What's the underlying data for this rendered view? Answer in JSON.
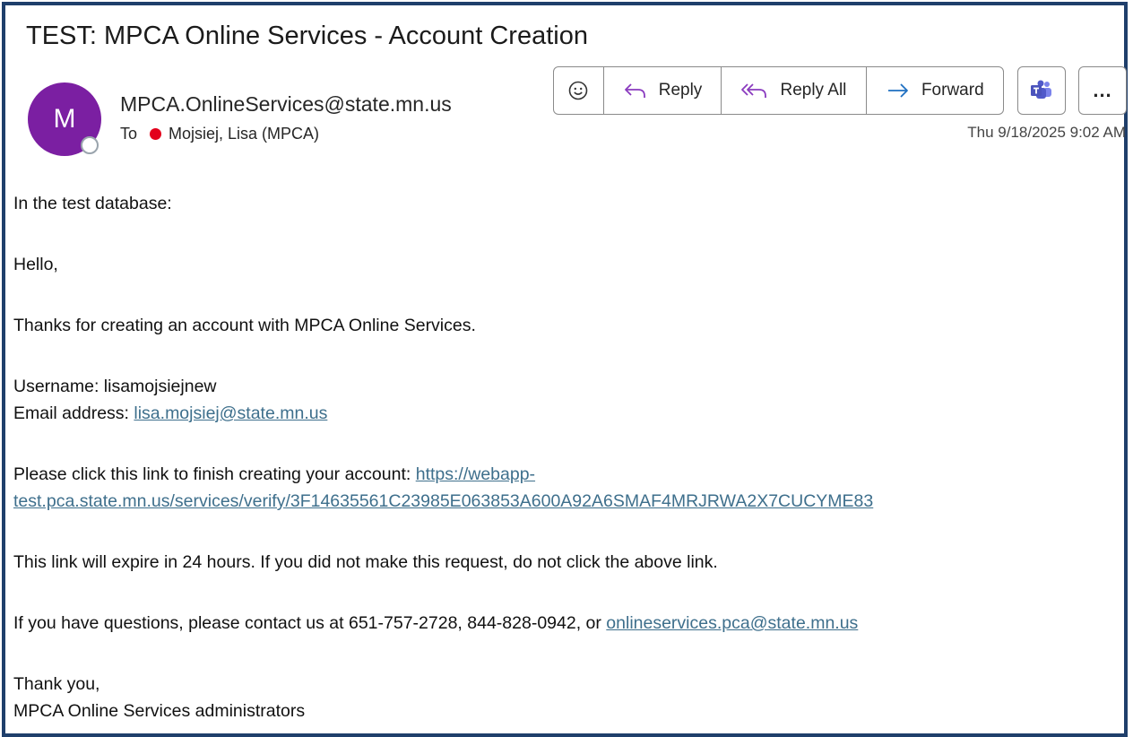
{
  "email": {
    "subject": "TEST: MPCA Online Services - Account Creation",
    "avatar_initial": "M",
    "sender": "MPCA.OnlineServices@state.mn.us",
    "to_label": "To",
    "recipient": "Mojsiej, Lisa (MPCA)",
    "date": "Thu 9/18/2025 9:02 AM"
  },
  "toolbar": {
    "reply": "Reply",
    "reply_all": "Reply All",
    "forward": "Forward",
    "more": "..."
  },
  "body": {
    "line1": "In the test database:",
    "greeting": "Hello,",
    "thanks": "Thanks for creating an account with MPCA Online Services.",
    "username": "Username: lisamojsiejnew",
    "email_label": "Email address: ",
    "email_link": "lisa.mojsiej@state.mn.us",
    "click_prefix": "Please click this link to finish creating your account: ",
    "verify_link_part1": "https://webapp-",
    "verify_link_part2": "test.pca.state.mn.us/services/verify/3F14635561C23985E063853A600A92A6SMAF4MRJRWA2X7CUCYME83",
    "expire": "This link will expire in 24 hours. If you did not make this request, do not click the above link.",
    "contact_prefix": "If you have questions, please contact us at 651-757-2728, 844-828-0942, or ",
    "contact_link": "onlineservices.pca@state.mn.us",
    "signoff": "Thank you,",
    "signature": "MPCA Online Services administrators"
  },
  "colors": {
    "avatar_bg": "#7b1fa2",
    "presence_busy": "#e3001b",
    "link": "#3e6f8c",
    "frame": "#1f3f6b"
  }
}
